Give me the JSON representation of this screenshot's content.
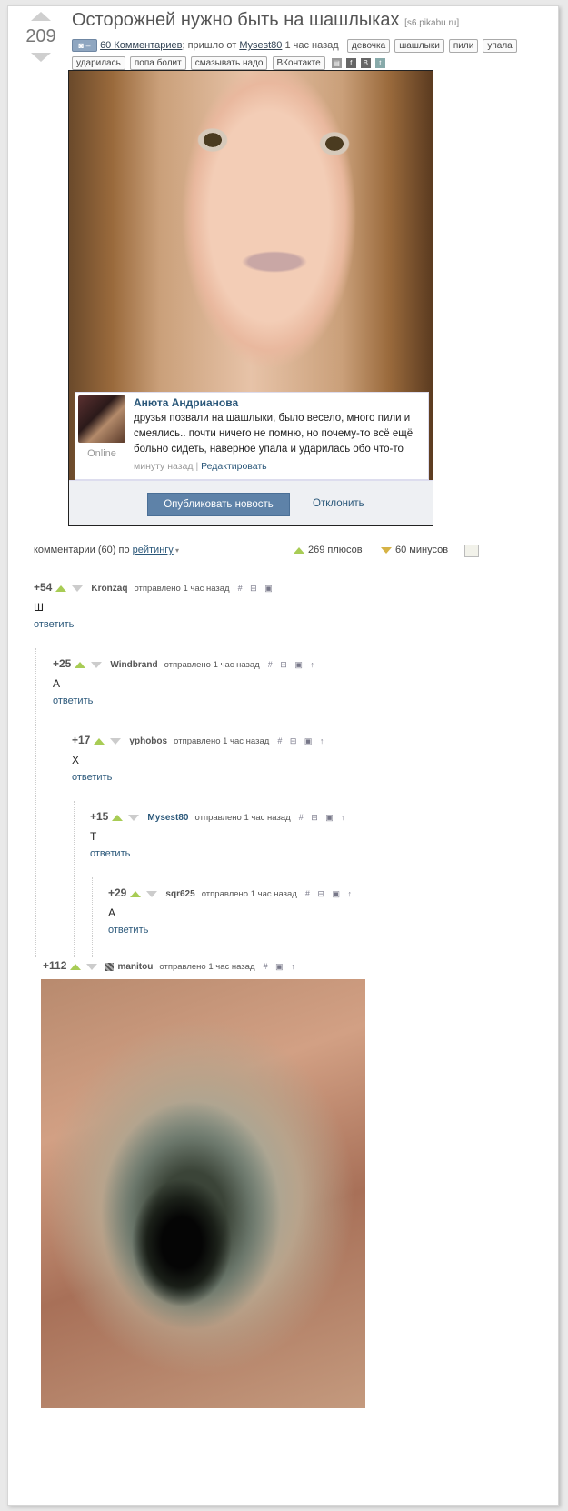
{
  "post": {
    "votes": "209",
    "title": "Осторожней нужно быть на шашлыках",
    "domain": "[s6.pikabu.ru]",
    "comments_link": "60 Комментариев",
    "from_prefix": "; пришло от",
    "author": "Mysest80",
    "time": "1 час назад",
    "tags": [
      "девочка",
      "шашлыки",
      "пили",
      "упала",
      "ударилась",
      "попа болит",
      "смазывать надо",
      "ВКонтакте"
    ],
    "share_icons": [
      "save-icon",
      "facebook-icon",
      "vk-icon",
      "twitter-icon"
    ]
  },
  "vk": {
    "name": "Анюта Андрианова",
    "text": "друзья позвали на шашлыки, было весело, много пили и смеялись.. почти ничего не помню, но почему-то всё ещё больно сидеть, наверное упала и ударилась обо что-то",
    "online": "Online",
    "time": "минуту назад",
    "separator": "|",
    "edit": "Редактировать",
    "publish_button": "Опубликовать новость",
    "reject_link": "Отклонить"
  },
  "comments_bar": {
    "label": "комментарии (60) по",
    "sort": "рейтингу",
    "plus": "269 плюсов",
    "minus": "60 минусов"
  },
  "comments": [
    {
      "score": "+54",
      "author": "Kronzaq",
      "ago": "отправлено 1 час назад",
      "icons": "# ⊟ ▣",
      "text": "Ш",
      "reply": "ответить"
    },
    {
      "score": "+25",
      "author": "Windbrand",
      "ago": "отправлено 1 час назад",
      "icons": "# ⊟ ▣ ↑",
      "text": "А",
      "reply": "ответить"
    },
    {
      "score": "+17",
      "author": "yphobos",
      "ago": "отправлено 1 час назад",
      "icons": "# ⊟ ▣ ↑",
      "text": "Х",
      "reply": "ответить"
    },
    {
      "score": "+15",
      "author": "Mysest80",
      "ago": "отправлено 1 час назад",
      "icons": "# ⊟ ▣ ↑",
      "text": "Т",
      "reply": "ответить"
    },
    {
      "score": "+29",
      "author": "sqr625",
      "ago": "отправлено 1 час назад",
      "icons": "# ⊟ ▣ ↑",
      "text": "А",
      "reply": "ответить"
    },
    {
      "score": "+112",
      "author": "manitou",
      "ago": "отправлено 1 час назад",
      "icons": "# ▣ ↑"
    }
  ],
  "colors": {
    "link": "#2b587a",
    "plus": "#a8cc55",
    "minus": "#d6b346",
    "vk_button": "#5e82a8"
  }
}
